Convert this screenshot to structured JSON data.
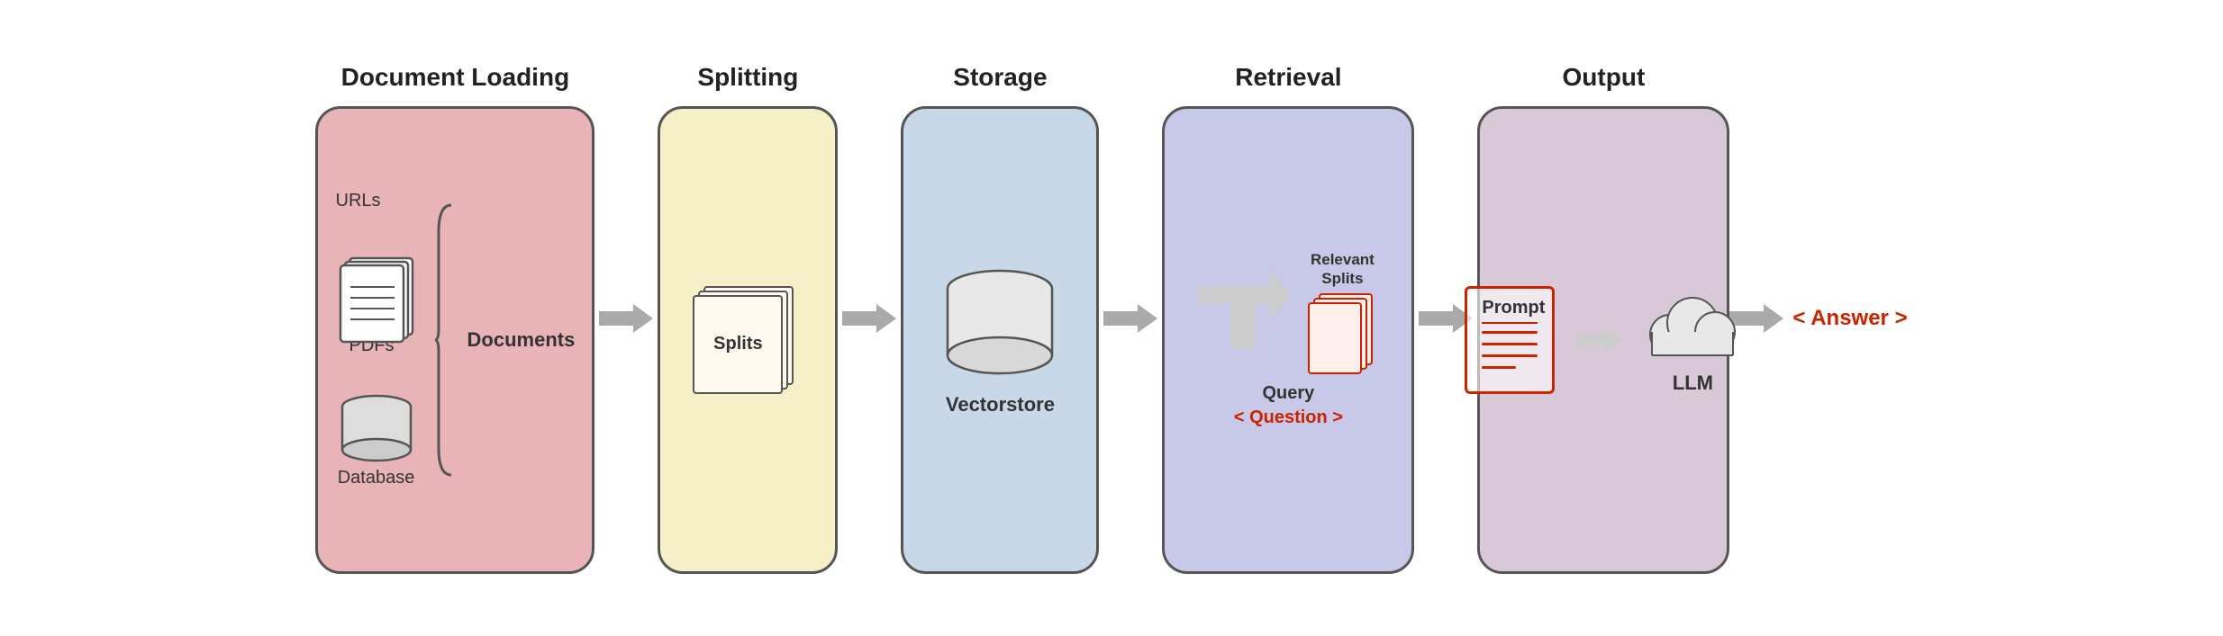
{
  "stages": [
    {
      "id": "doc-loading",
      "title": "Document Loading"
    },
    {
      "id": "splitting",
      "title": "Splitting"
    },
    {
      "id": "storage",
      "title": "Storage"
    },
    {
      "id": "retrieval",
      "title": "Retrieval"
    },
    {
      "id": "output",
      "title": "Output"
    }
  ],
  "doc_loading": {
    "urls_label": "URLs",
    "pdfs_label": "PDFs",
    "database_label": "Database",
    "documents_label": "Documents"
  },
  "splitting": {
    "splits_label": "Splits"
  },
  "storage": {
    "vectorstore_label": "Vectorstore"
  },
  "retrieval": {
    "relevant_splits_label": "Relevant\nSplits",
    "query_label": "Query",
    "question_label": "< Question >"
  },
  "output": {
    "prompt_label": "Prompt",
    "llm_label": "LLM",
    "answer_label": "< Answer >"
  },
  "arrows": {
    "arrow_color": "#aaaaaa"
  }
}
